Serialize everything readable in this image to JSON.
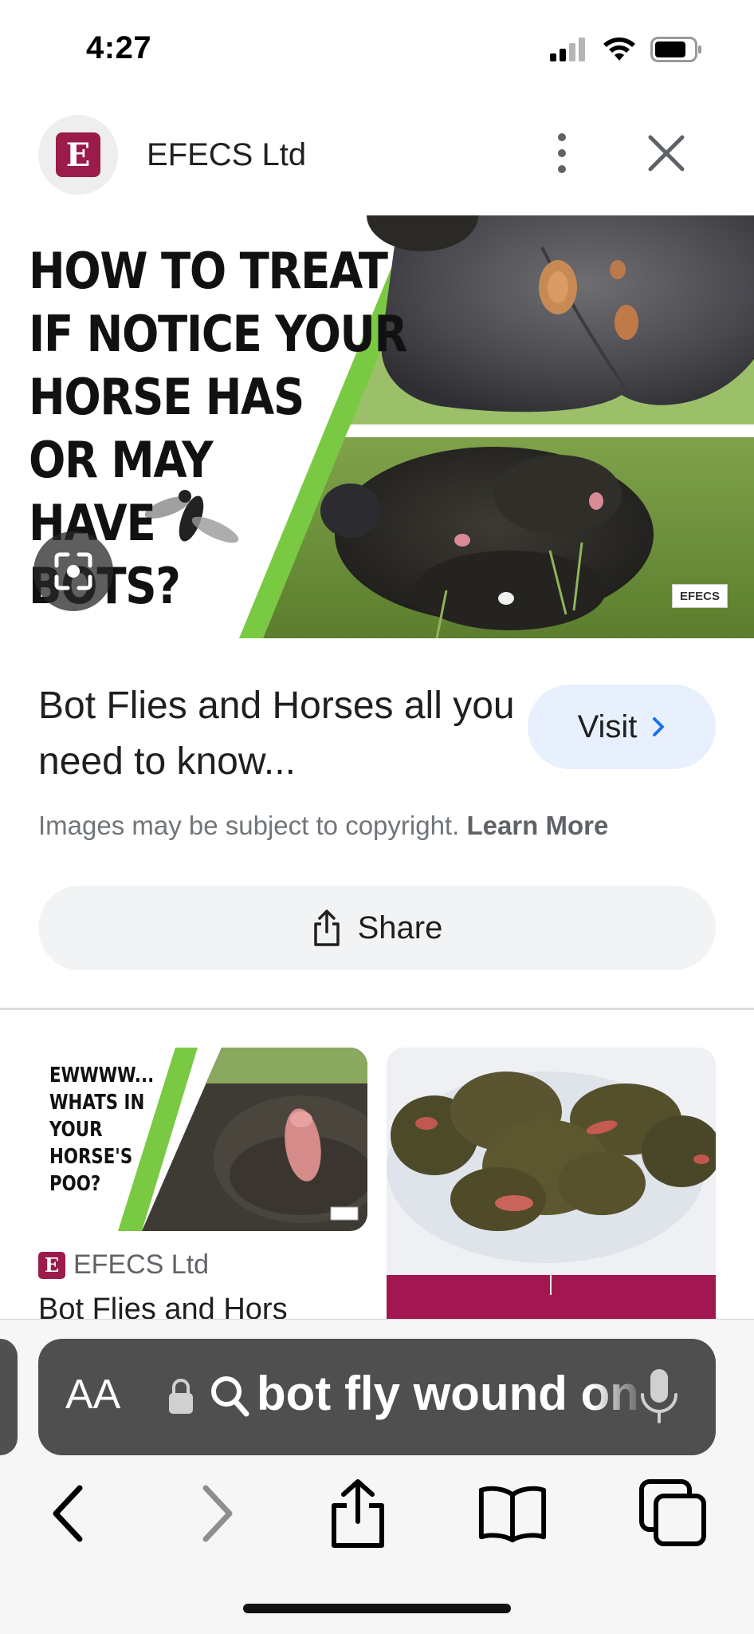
{
  "status_bar": {
    "time": "4:27"
  },
  "header": {
    "site_name": "EFECS Ltd",
    "logo_letter": "E"
  },
  "hero": {
    "title_lines": [
      "HOW TO TREAT",
      "IF NOTICE YOUR",
      "HORSE HAS",
      "OR MAY",
      "HAVE",
      "BOTS?"
    ],
    "watermark": "EFECS"
  },
  "result": {
    "title": "Bot Flies and Horses all you need to know...",
    "visit_label": "Visit",
    "copyright_text": "Images may be subject to copyright.",
    "learn_more": "Learn More",
    "share_label": "Share"
  },
  "related": {
    "card1_lines": [
      "EWWWW...",
      "WHATS IN",
      "YOUR",
      "HORSE'S",
      "POO?"
    ],
    "card1_source": "EFECS Ltd",
    "card1_title": "Bot Flies and Hors"
  },
  "browser": {
    "aa_label": "AA",
    "address_text": "bot fly wound on horse"
  },
  "colors": {
    "brand": "#9b1b4a",
    "accent_green": "#7ac943",
    "link_blue": "#1a73e8"
  },
  "icons": [
    "signal-icon",
    "wifi-icon",
    "battery-icon",
    "more-vert-icon",
    "close-icon",
    "lens-icon",
    "chevron-right-icon",
    "share-icon",
    "lock-icon",
    "search-icon",
    "mic-icon",
    "back-icon",
    "forward-icon",
    "share-icon",
    "bookmarks-icon",
    "tabs-icon"
  ]
}
